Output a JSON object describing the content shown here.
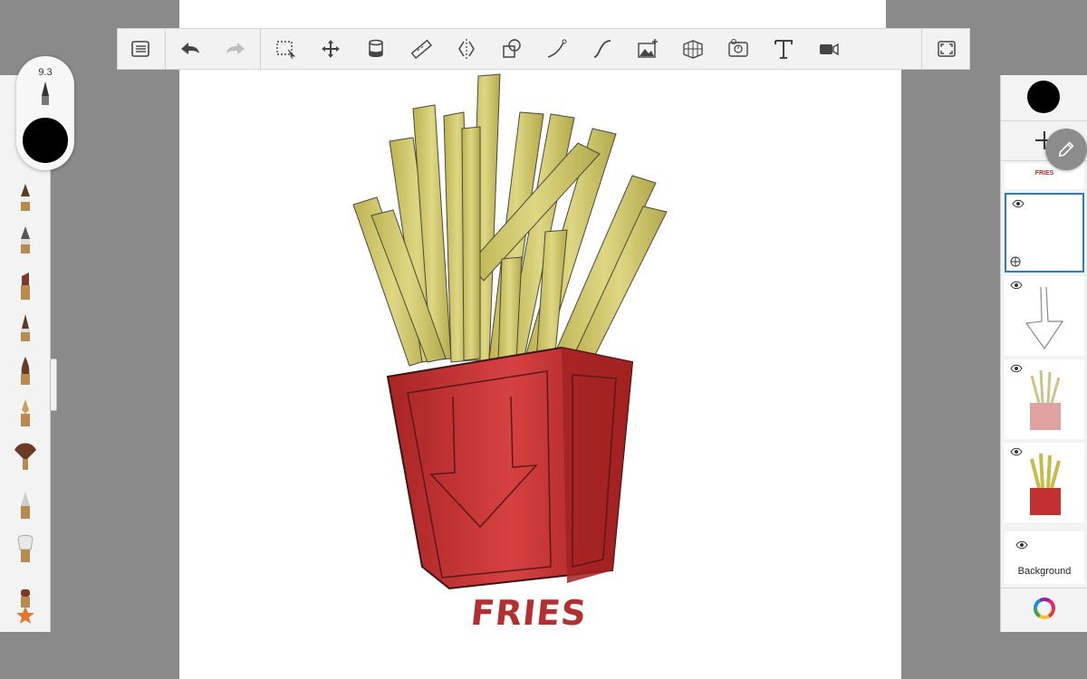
{
  "toolbar": {
    "items": [
      {
        "name": "menu-list-icon"
      },
      {
        "name": "undo-icon"
      },
      {
        "name": "redo-icon"
      },
      {
        "name": "selection-icon"
      },
      {
        "name": "transform-icon"
      },
      {
        "name": "fill-bucket-icon"
      },
      {
        "name": "ruler-icon"
      },
      {
        "name": "symmetry-icon"
      },
      {
        "name": "shape-icon"
      },
      {
        "name": "stroke-icon"
      },
      {
        "name": "curve-icon"
      },
      {
        "name": "add-image-icon"
      },
      {
        "name": "perspective-grid-icon"
      },
      {
        "name": "time-lapse-icon"
      },
      {
        "name": "text-icon"
      },
      {
        "name": "video-icon"
      },
      {
        "name": "fullscreen-icon"
      }
    ]
  },
  "brush_panel": {
    "size_value": "9.3",
    "color": "#000000",
    "brushes": [
      "pencil",
      "hard-pencil",
      "marker",
      "ink-pen",
      "paint-brush",
      "fountain-pen",
      "fan-brush",
      "airbrush",
      "smudge",
      "flat-brush",
      "favorites-star"
    ]
  },
  "layers_panel": {
    "current_color": "#000000",
    "text_layer_label": "FRIES",
    "background_label": "Background"
  },
  "canvas": {
    "caption": "FRIES",
    "colors": {
      "fries": "#c9c05a",
      "box": "#c02f2f",
      "outline": "#2b2b2b"
    }
  }
}
